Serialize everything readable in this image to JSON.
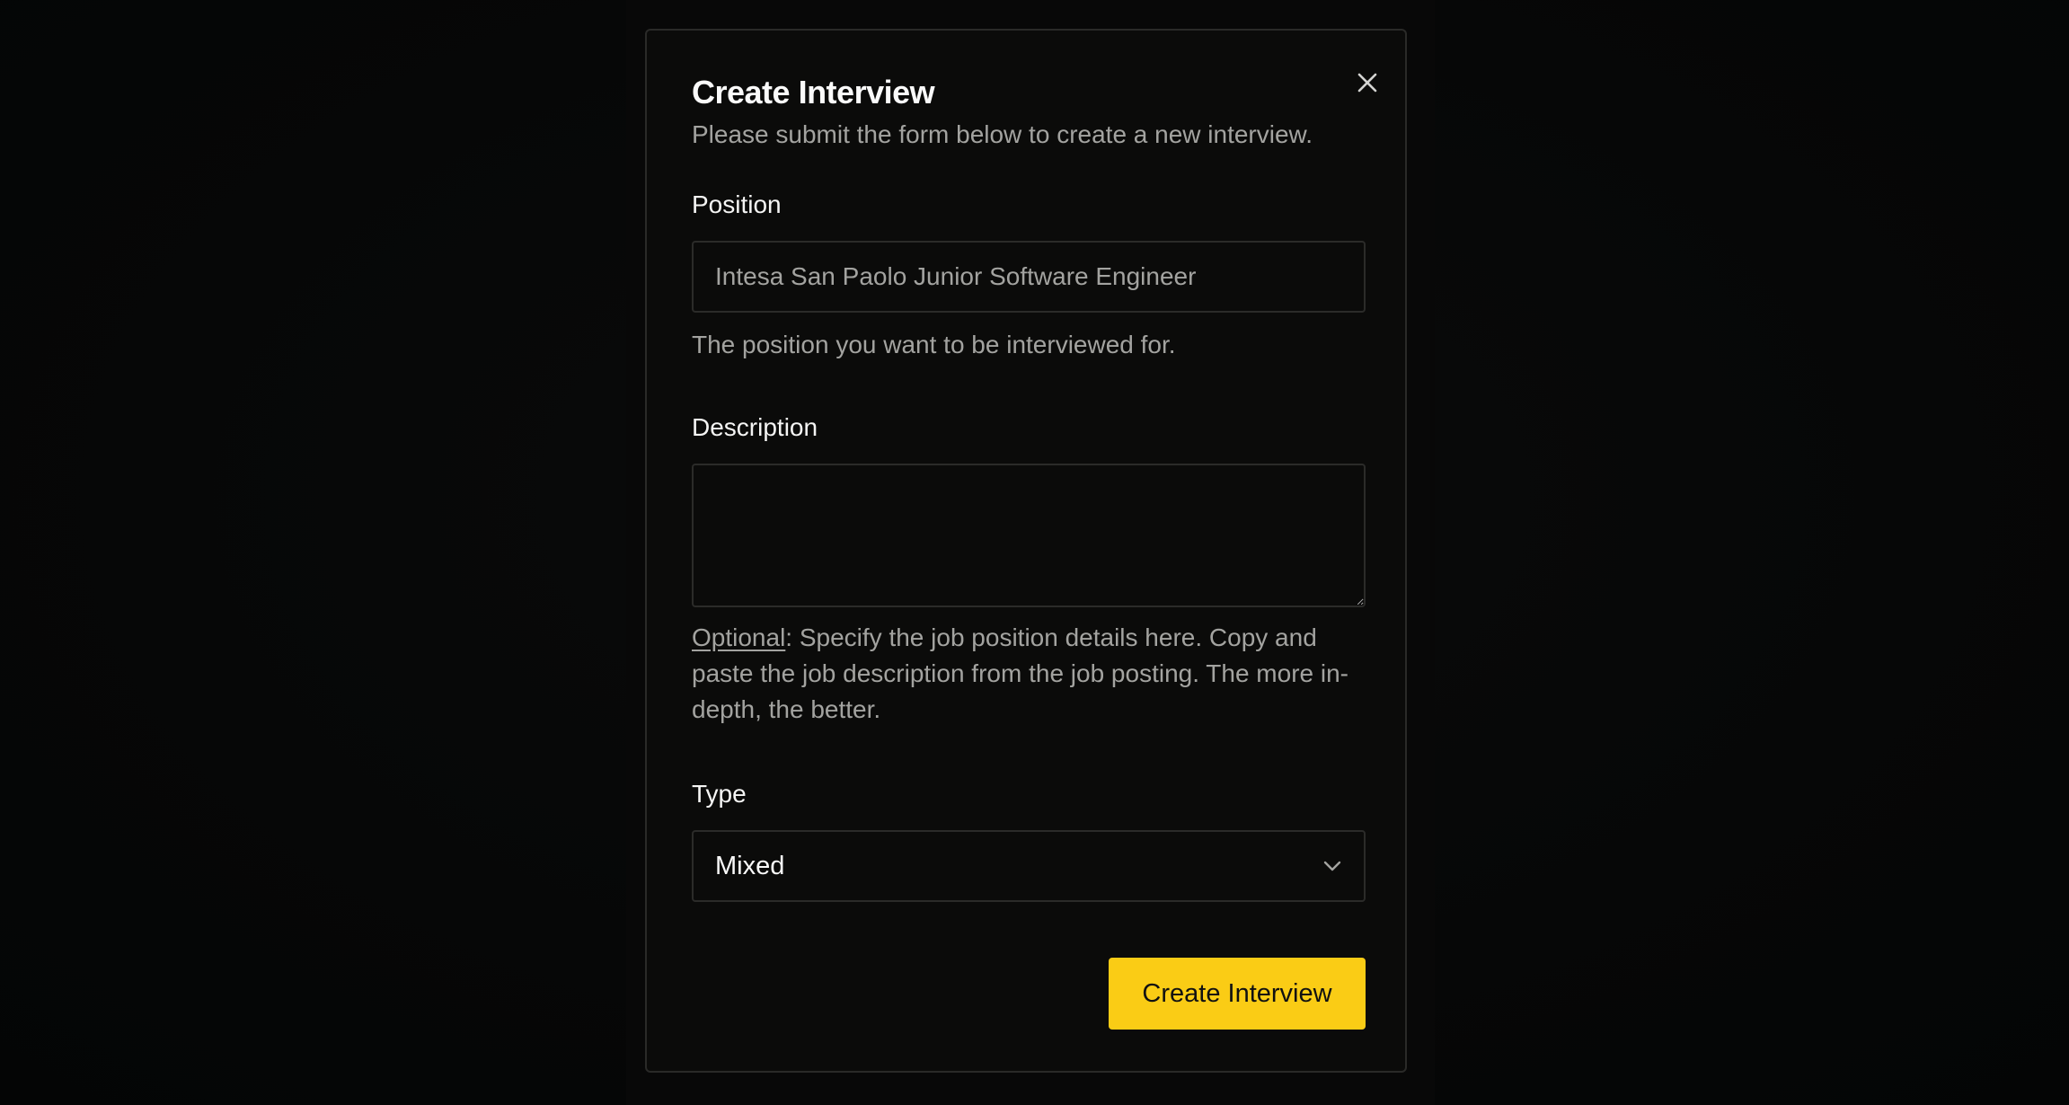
{
  "dialog": {
    "title": "Create Interview",
    "subtitle": "Please submit the form below to create a new interview.",
    "close_icon": "close-icon"
  },
  "position": {
    "label": "Position",
    "placeholder": "Intesa San Paolo Junior Software Engineer",
    "value": "",
    "help": "The position you want to be interviewed for."
  },
  "description": {
    "label": "Description",
    "value": "",
    "help_prefix": "Optional",
    "help_text": ": Specify the job position details here. Copy and paste the job description from the job posting. The more in-depth, the better."
  },
  "type": {
    "label": "Type",
    "selected": "Mixed",
    "icon": "chevron-down-icon"
  },
  "submit": {
    "label": "Create Interview"
  },
  "colors": {
    "accent": "#facc15",
    "background": "#0b0b0a",
    "border": "#2b2b29",
    "muted_text": "#a3a3a0"
  }
}
